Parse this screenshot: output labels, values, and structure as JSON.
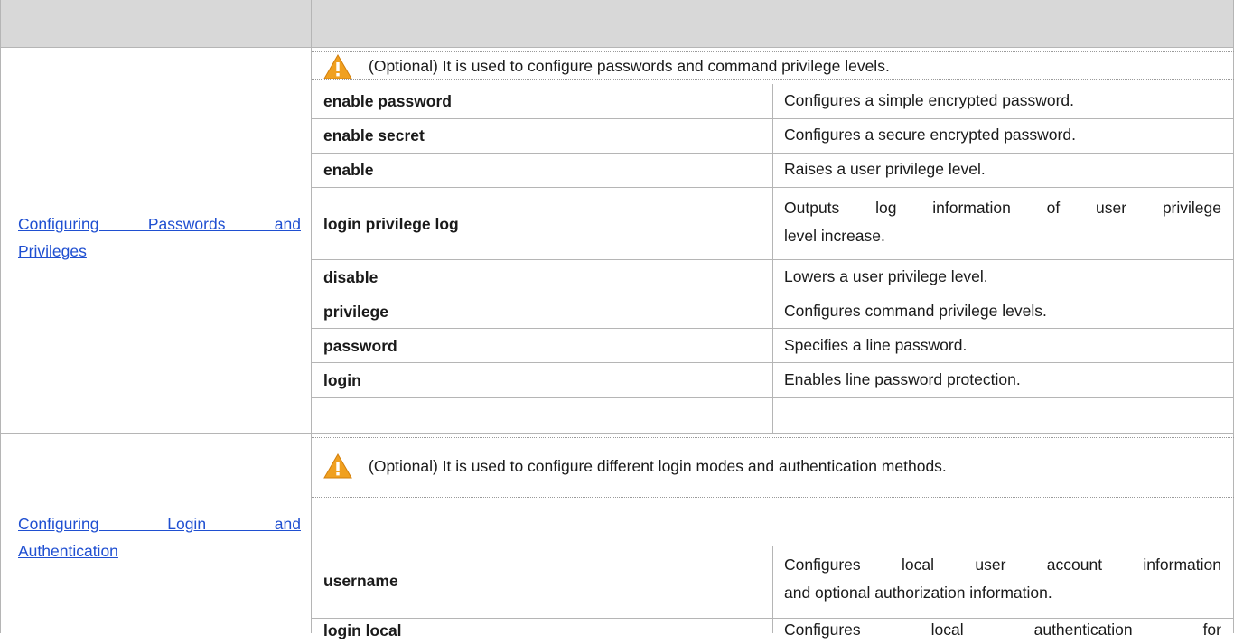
{
  "header": {
    "col1": "",
    "col2": ""
  },
  "sections": [
    {
      "link_lines": [
        "Configuring Passwords and",
        "Privileges"
      ],
      "note": "(Optional) It is used to configure passwords and command privilege levels.",
      "rows": [
        {
          "command": "enable password",
          "desc_lines": [
            "Configures a simple encrypted password."
          ]
        },
        {
          "command": "enable secret",
          "desc_lines": [
            "Configures a secure encrypted password."
          ]
        },
        {
          "command": "enable",
          "desc_lines": [
            "Raises a user privilege level."
          ]
        },
        {
          "command": "login privilege log",
          "desc_lines": [
            "Outputs log information of user privilege",
            "level increase."
          ]
        },
        {
          "command": "disable",
          "desc_lines": [
            "Lowers a user privilege level."
          ]
        },
        {
          "command": "privilege",
          "desc_lines": [
            "Configures command privilege levels."
          ]
        },
        {
          "command": "password",
          "desc_lines": [
            "Specifies a line password."
          ]
        },
        {
          "command": "login",
          "desc_lines": [
            "Enables line password protection."
          ]
        }
      ]
    },
    {
      "link_lines": [
        "Configuring Login and",
        "Authentication"
      ],
      "note": "(Optional) It is used to configure different login modes and authentication methods.",
      "rows": [
        {
          "command": "username",
          "desc_lines": [
            "Configures local user account information",
            "and optional authorization information."
          ]
        },
        {
          "command": "login local",
          "desc_lines": [
            "Configures local authentication for"
          ]
        }
      ]
    }
  ],
  "colors": {
    "header_bg": "#d8d8d8",
    "link": "#1f4fd1",
    "warn": "#f0a020",
    "grid": "#b5b5b5"
  },
  "icons": {
    "warning": "warning-icon"
  }
}
